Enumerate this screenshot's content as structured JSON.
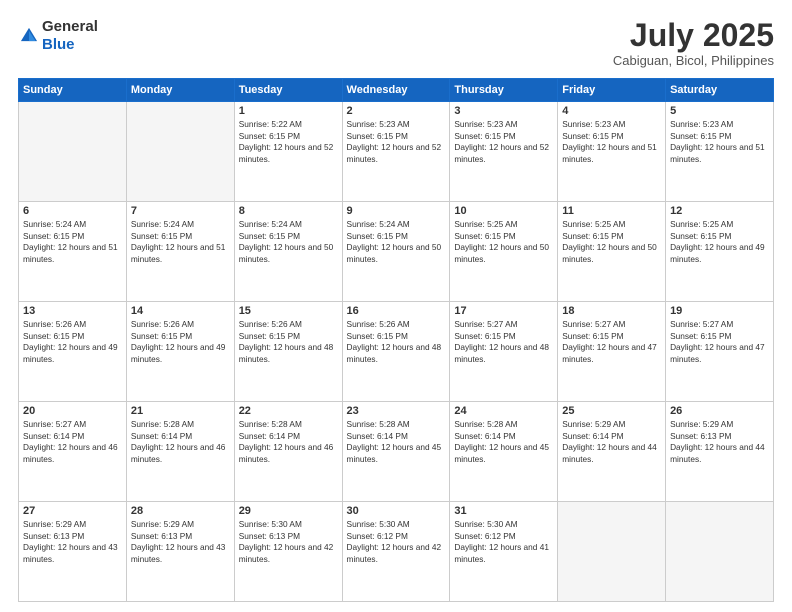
{
  "header": {
    "logo_line1": "General",
    "logo_line2": "Blue",
    "month_year": "July 2025",
    "location": "Cabiguan, Bicol, Philippines"
  },
  "weekdays": [
    "Sunday",
    "Monday",
    "Tuesday",
    "Wednesday",
    "Thursday",
    "Friday",
    "Saturday"
  ],
  "rows": [
    [
      {
        "day": "",
        "empty": true
      },
      {
        "day": "",
        "empty": true
      },
      {
        "day": "1",
        "sunrise": "5:22 AM",
        "sunset": "6:15 PM",
        "daylight": "12 hours and 52 minutes."
      },
      {
        "day": "2",
        "sunrise": "5:23 AM",
        "sunset": "6:15 PM",
        "daylight": "12 hours and 52 minutes."
      },
      {
        "day": "3",
        "sunrise": "5:23 AM",
        "sunset": "6:15 PM",
        "daylight": "12 hours and 52 minutes."
      },
      {
        "day": "4",
        "sunrise": "5:23 AM",
        "sunset": "6:15 PM",
        "daylight": "12 hours and 51 minutes."
      },
      {
        "day": "5",
        "sunrise": "5:23 AM",
        "sunset": "6:15 PM",
        "daylight": "12 hours and 51 minutes."
      }
    ],
    [
      {
        "day": "6",
        "sunrise": "5:24 AM",
        "sunset": "6:15 PM",
        "daylight": "12 hours and 51 minutes."
      },
      {
        "day": "7",
        "sunrise": "5:24 AM",
        "sunset": "6:15 PM",
        "daylight": "12 hours and 51 minutes."
      },
      {
        "day": "8",
        "sunrise": "5:24 AM",
        "sunset": "6:15 PM",
        "daylight": "12 hours and 50 minutes."
      },
      {
        "day": "9",
        "sunrise": "5:24 AM",
        "sunset": "6:15 PM",
        "daylight": "12 hours and 50 minutes."
      },
      {
        "day": "10",
        "sunrise": "5:25 AM",
        "sunset": "6:15 PM",
        "daylight": "12 hours and 50 minutes."
      },
      {
        "day": "11",
        "sunrise": "5:25 AM",
        "sunset": "6:15 PM",
        "daylight": "12 hours and 50 minutes."
      },
      {
        "day": "12",
        "sunrise": "5:25 AM",
        "sunset": "6:15 PM",
        "daylight": "12 hours and 49 minutes."
      }
    ],
    [
      {
        "day": "13",
        "sunrise": "5:26 AM",
        "sunset": "6:15 PM",
        "daylight": "12 hours and 49 minutes."
      },
      {
        "day": "14",
        "sunrise": "5:26 AM",
        "sunset": "6:15 PM",
        "daylight": "12 hours and 49 minutes."
      },
      {
        "day": "15",
        "sunrise": "5:26 AM",
        "sunset": "6:15 PM",
        "daylight": "12 hours and 48 minutes."
      },
      {
        "day": "16",
        "sunrise": "5:26 AM",
        "sunset": "6:15 PM",
        "daylight": "12 hours and 48 minutes."
      },
      {
        "day": "17",
        "sunrise": "5:27 AM",
        "sunset": "6:15 PM",
        "daylight": "12 hours and 48 minutes."
      },
      {
        "day": "18",
        "sunrise": "5:27 AM",
        "sunset": "6:15 PM",
        "daylight": "12 hours and 47 minutes."
      },
      {
        "day": "19",
        "sunrise": "5:27 AM",
        "sunset": "6:15 PM",
        "daylight": "12 hours and 47 minutes."
      }
    ],
    [
      {
        "day": "20",
        "sunrise": "5:27 AM",
        "sunset": "6:14 PM",
        "daylight": "12 hours and 46 minutes."
      },
      {
        "day": "21",
        "sunrise": "5:28 AM",
        "sunset": "6:14 PM",
        "daylight": "12 hours and 46 minutes."
      },
      {
        "day": "22",
        "sunrise": "5:28 AM",
        "sunset": "6:14 PM",
        "daylight": "12 hours and 46 minutes."
      },
      {
        "day": "23",
        "sunrise": "5:28 AM",
        "sunset": "6:14 PM",
        "daylight": "12 hours and 45 minutes."
      },
      {
        "day": "24",
        "sunrise": "5:28 AM",
        "sunset": "6:14 PM",
        "daylight": "12 hours and 45 minutes."
      },
      {
        "day": "25",
        "sunrise": "5:29 AM",
        "sunset": "6:14 PM",
        "daylight": "12 hours and 44 minutes."
      },
      {
        "day": "26",
        "sunrise": "5:29 AM",
        "sunset": "6:13 PM",
        "daylight": "12 hours and 44 minutes."
      }
    ],
    [
      {
        "day": "27",
        "sunrise": "5:29 AM",
        "sunset": "6:13 PM",
        "daylight": "12 hours and 43 minutes."
      },
      {
        "day": "28",
        "sunrise": "5:29 AM",
        "sunset": "6:13 PM",
        "daylight": "12 hours and 43 minutes."
      },
      {
        "day": "29",
        "sunrise": "5:30 AM",
        "sunset": "6:13 PM",
        "daylight": "12 hours and 42 minutes."
      },
      {
        "day": "30",
        "sunrise": "5:30 AM",
        "sunset": "6:12 PM",
        "daylight": "12 hours and 42 minutes."
      },
      {
        "day": "31",
        "sunrise": "5:30 AM",
        "sunset": "6:12 PM",
        "daylight": "12 hours and 41 minutes."
      },
      {
        "day": "",
        "empty": true
      },
      {
        "day": "",
        "empty": true
      }
    ]
  ]
}
